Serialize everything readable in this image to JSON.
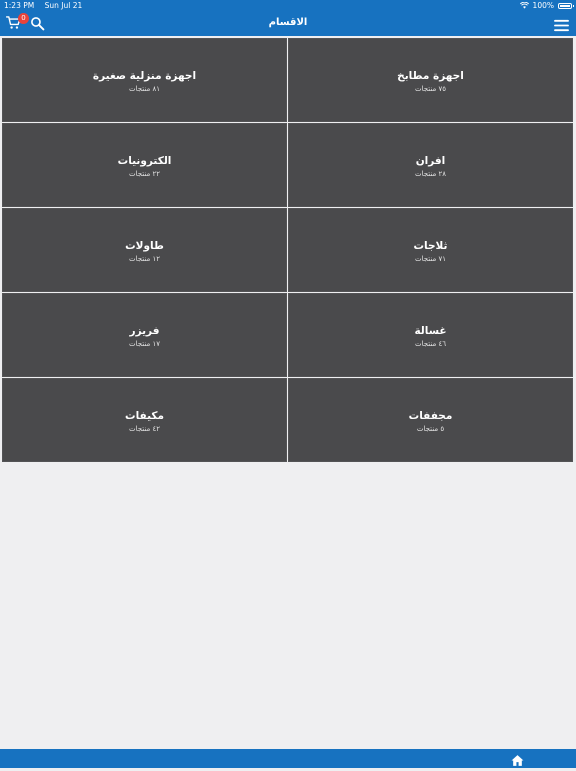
{
  "status_bar": {
    "time": "1:23 PM",
    "date": "Sun Jul 21",
    "battery": "100%",
    "wifi_icon": "wifi-icon",
    "battery_icon": "battery-icon"
  },
  "nav": {
    "title": "الاقسام",
    "cart_badge": "0",
    "cart_icon": "cart-icon",
    "search_icon": "search-icon",
    "menu_icon": "hamburger-menu-icon"
  },
  "categories": [
    {
      "name": "اجهزة مطابخ",
      "count": "٧٥ منتجات"
    },
    {
      "name": "اجهزة منزلية صغيرة",
      "count": "٨١ منتجات"
    },
    {
      "name": "افران",
      "count": "٢٨ منتجات"
    },
    {
      "name": "الكترونيات",
      "count": "٢٢ منتجات"
    },
    {
      "name": "ثلاجات",
      "count": "٧١ منتجات"
    },
    {
      "name": "طاولات",
      "count": "١٢ منتجات"
    },
    {
      "name": "غسالة",
      "count": "٤٦ منتجات"
    },
    {
      "name": "فريزر",
      "count": "١٧ منتجات"
    },
    {
      "name": "مجففات",
      "count": "٥ منتجات"
    },
    {
      "name": "مكيفات",
      "count": "٤٢ منتجات"
    }
  ],
  "bottom_bar": {
    "home_icon": "home-icon"
  },
  "colors": {
    "primary": "#1772c0",
    "tile": "#4a4a4c",
    "background": "#efeff1",
    "badge": "#e8433a"
  }
}
